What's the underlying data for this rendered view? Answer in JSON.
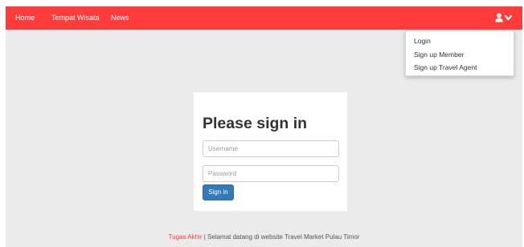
{
  "nav": {
    "items": [
      {
        "label": "Home"
      },
      {
        "label": "Tempat Wisata"
      },
      {
        "label": "News"
      }
    ],
    "user_icon": "user-icon",
    "caret_icon": "chevron-down-icon"
  },
  "dropdown": {
    "items": [
      {
        "label": "Login"
      },
      {
        "label": "Sign up Member"
      },
      {
        "label": "Sign up Travel Agent"
      }
    ]
  },
  "login": {
    "title": "Please sign in",
    "username_placeholder": "Username",
    "password_placeholder": "Password",
    "button_label": "Sign in"
  },
  "footer": {
    "link_text": "Tugas Akhir",
    "separator": " | ",
    "text": "Selamat datang di website Travel Market Pulau Timor"
  },
  "colors": {
    "brand": "#ff3b3b",
    "primary_button": "#337ab7",
    "page_background": "#ebebeb"
  }
}
